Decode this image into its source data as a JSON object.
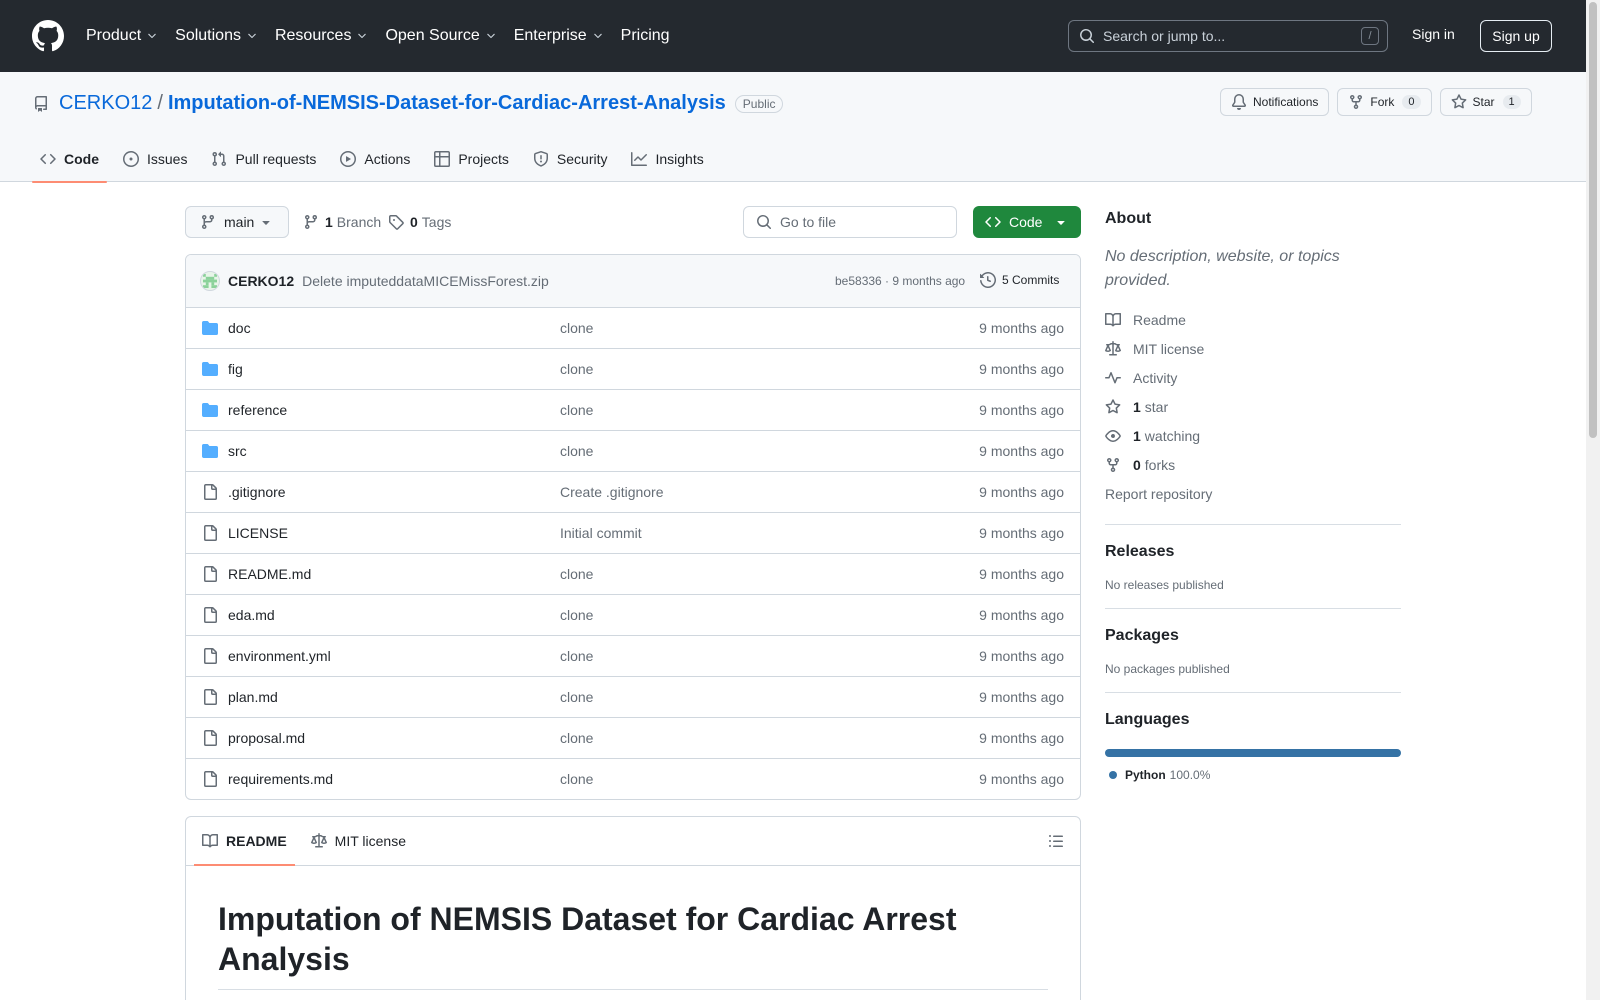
{
  "header": {
    "nav": [
      {
        "label": "Product",
        "has_menu": true
      },
      {
        "label": "Solutions",
        "has_menu": true
      },
      {
        "label": "Resources",
        "has_menu": true
      },
      {
        "label": "Open Source",
        "has_menu": true
      },
      {
        "label": "Enterprise",
        "has_menu": true
      },
      {
        "label": "Pricing",
        "has_menu": false
      }
    ],
    "search_placeholder": "Search or jump to...",
    "search_key": "/",
    "sign_in": "Sign in",
    "sign_up": "Sign up"
  },
  "repo": {
    "owner": "CERKO12",
    "separator": "/",
    "name": "Imputation-of-NEMSIS-Dataset-for-Cardiac-Arrest-Analysis",
    "visibility": "Public",
    "notifications_label": "Notifications",
    "fork_label": "Fork",
    "fork_count": "0",
    "star_label": "Star",
    "star_count": "1",
    "tabs": [
      "Code",
      "Issues",
      "Pull requests",
      "Actions",
      "Projects",
      "Security",
      "Insights"
    ]
  },
  "toolbar": {
    "branch": "main",
    "branch_count": "1",
    "branch_label": "Branch",
    "tag_count": "0",
    "tag_label": "Tags",
    "goto_placeholder": "Go to file",
    "code_button": "Code"
  },
  "commit": {
    "author": "CERKO12",
    "message": "Delete imputeddataMICEMissForest.zip",
    "sha_time": "be58336 · 9 months ago",
    "commits_label": "5 Commits"
  },
  "files": [
    {
      "name": "doc",
      "type": "folder",
      "message": "clone",
      "date": "9 months ago"
    },
    {
      "name": "fig",
      "type": "folder",
      "message": "clone",
      "date": "9 months ago"
    },
    {
      "name": "reference",
      "type": "folder",
      "message": "clone",
      "date": "9 months ago"
    },
    {
      "name": "src",
      "type": "folder",
      "message": "clone",
      "date": "9 months ago"
    },
    {
      "name": ".gitignore",
      "type": "file",
      "message": "Create .gitignore",
      "date": "9 months ago"
    },
    {
      "name": "LICENSE",
      "type": "file",
      "message": "Initial commit",
      "date": "9 months ago"
    },
    {
      "name": "README.md",
      "type": "file",
      "message": "clone",
      "date": "9 months ago"
    },
    {
      "name": "eda.md",
      "type": "file",
      "message": "clone",
      "date": "9 months ago"
    },
    {
      "name": "environment.yml",
      "type": "file",
      "message": "clone",
      "date": "9 months ago"
    },
    {
      "name": "plan.md",
      "type": "file",
      "message": "clone",
      "date": "9 months ago"
    },
    {
      "name": "proposal.md",
      "type": "file",
      "message": "clone",
      "date": "9 months ago"
    },
    {
      "name": "requirements.md",
      "type": "file",
      "message": "clone",
      "date": "9 months ago"
    }
  ],
  "readme": {
    "tab_readme": "README",
    "tab_license": "MIT license",
    "heading": "Imputation of NEMSIS Dataset for Cardiac Arrest Analysis"
  },
  "sidebar": {
    "about_title": "About",
    "about_desc": "No description, website, or topics provided.",
    "readme": "Readme",
    "license": "MIT license",
    "activity": "Activity",
    "stars_count": "1",
    "stars_label": "star",
    "watching_count": "1",
    "watching_label": "watching",
    "forks_count": "0",
    "forks_label": "forks",
    "report": "Report repository",
    "releases_title": "Releases",
    "releases_empty": "No releases published",
    "packages_title": "Packages",
    "packages_empty": "No packages published",
    "languages_title": "Languages",
    "language_name": "Python",
    "language_pct": "100.0%",
    "language_color": "#3572a5"
  },
  "colors": {
    "header_bg": "#24292f",
    "link": "#0969da",
    "primary_button": "#1f883d",
    "active_tab_underline": "#fd8c73",
    "folder_icon": "#54aeff"
  }
}
